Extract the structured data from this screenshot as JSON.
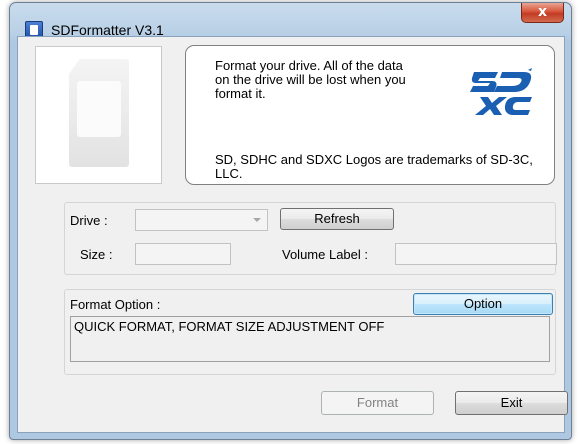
{
  "window": {
    "title": "SDFormatter V3.1",
    "close_glyph": "x"
  },
  "info": {
    "message": "Format your drive. All of the data on the drive will be lost when you format it.",
    "trademark": "SD, SDHC and SDXC Logos are trademarks of SD-3C, LLC.",
    "logo_icon": "sdxc-logo"
  },
  "drive": {
    "drive_label": "Drive :",
    "drive_value": "",
    "refresh_label": "Refresh",
    "size_label": "Size :",
    "size_value": "",
    "volume_label": "Volume Label :",
    "volume_value": ""
  },
  "format_option": {
    "group_label": "Format Option :",
    "option_button": "Option",
    "current_setting": "QUICK FORMAT, FORMAT SIZE ADJUSTMENT OFF"
  },
  "actions": {
    "format_label": "Format",
    "exit_label": "Exit"
  },
  "colors": {
    "logo_blue": "#1b5fb3",
    "focus_blue": "#3c7fb1"
  }
}
